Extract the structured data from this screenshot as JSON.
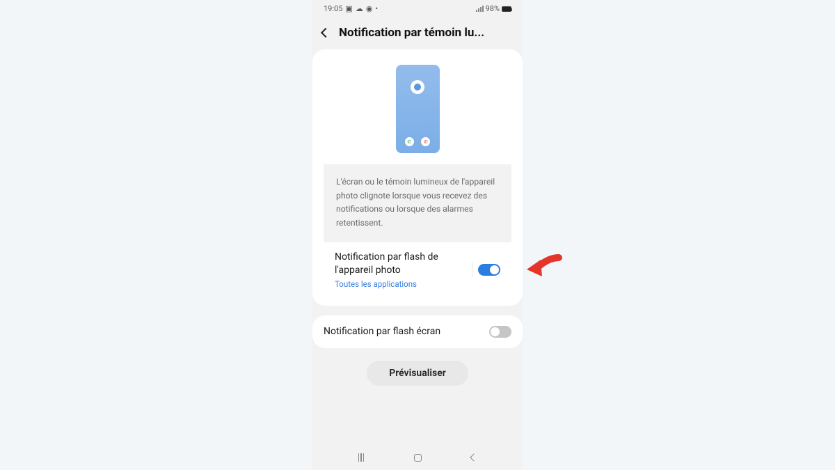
{
  "status": {
    "time": "19:05",
    "battery_pct": "98%"
  },
  "header": {
    "title": "Notification par témoin lu..."
  },
  "description": "L'écran ou le témoin lumineux de l'appareil photo clignote lorsque vous recevez des notifications ou lorsque des alarmes retentissent.",
  "settings": {
    "camera_flash": {
      "title": "Notification par flash de l'appareil photo",
      "subtitle": "Toutes les applications",
      "enabled": true
    },
    "screen_flash": {
      "title": "Notification par flash écran",
      "enabled": false
    }
  },
  "preview_button": "Prévisualiser"
}
